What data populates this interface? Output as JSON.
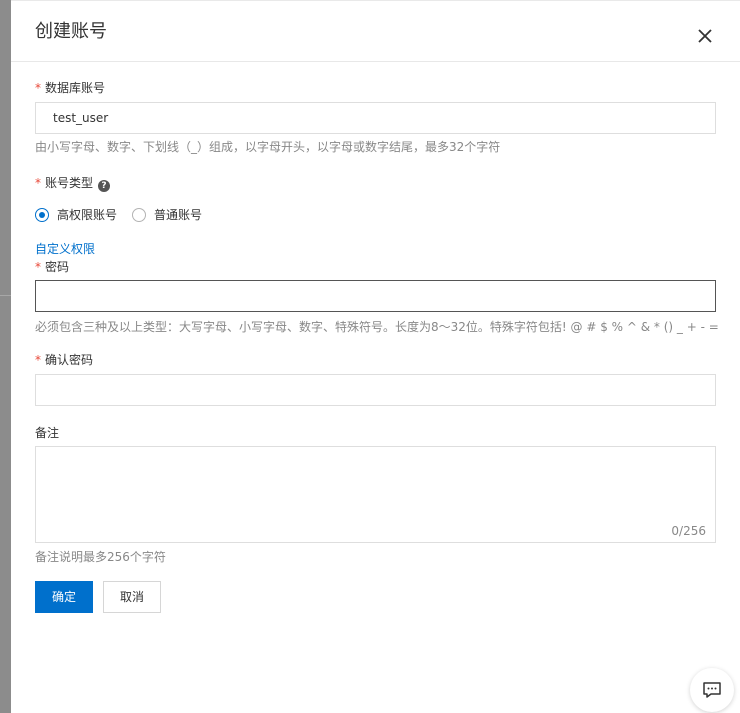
{
  "dialog": {
    "title": "创建账号"
  },
  "fields": {
    "db_account": {
      "required_mark": "*",
      "label": "数据库账号",
      "value": "test_user",
      "hint": "由小写字母、数字、下划线（_）组成，以字母开头，以字母或数字结尾，最多32个字符"
    },
    "account_type": {
      "required_mark": "*",
      "label": "账号类型",
      "help_icon": "question-circle-icon",
      "options": [
        "高权限账号",
        "普通账号"
      ],
      "selected": "高权限账号"
    },
    "custom_permission_link": "自定义权限",
    "password": {
      "required_mark": "*",
      "label": "密码",
      "value": "",
      "hint": "必须包含三种及以上类型：大写字母、小写字母、数字、特殊符号。长度为8～32位。特殊字符包括! @ # $ % ^ & * () _ + - ="
    },
    "confirm_password": {
      "required_mark": "*",
      "label": "确认密码",
      "value": ""
    },
    "remark": {
      "label": "备注",
      "value": "",
      "counter": "0/256",
      "hint": "备注说明最多256个字符"
    }
  },
  "buttons": {
    "confirm": "确定",
    "cancel": "取消"
  },
  "icons": {
    "close": "close-icon",
    "feedback": "chat-bubble-icon"
  },
  "colors": {
    "primary": "#0070cc",
    "required": "#e84738",
    "hint": "#888888",
    "border": "#dedede"
  }
}
